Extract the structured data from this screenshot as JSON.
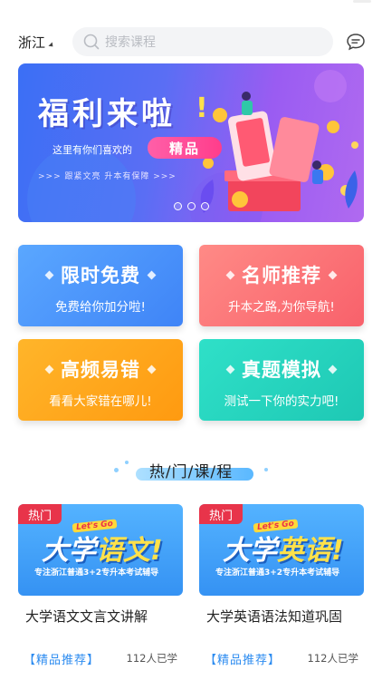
{
  "header": {
    "region": "浙江",
    "search_placeholder": "搜索课程"
  },
  "banner": {
    "title": "福利来啦",
    "exclaim": "!",
    "line1": "这里有你们喜欢的",
    "highlight": "精品",
    "line2": ">>> 跟紧文亮   升本有保障 >>>",
    "slides": 3,
    "active_slide": 2
  },
  "features": [
    {
      "title": "限时免费",
      "subtitle": "免费给你加分啦!"
    },
    {
      "title": "名师推荐",
      "subtitle": "升本之路,为你导航!"
    },
    {
      "title": "高频易错",
      "subtitle": "看看大家错在哪儿!"
    },
    {
      "title": "真题模拟",
      "subtitle": "测试一下你的实力吧!"
    }
  ],
  "section_title": "热/门/课/程",
  "courses": [
    {
      "hot": "热门",
      "logo": "Let's Go",
      "cover_prefix": "大学",
      "cover_highlight": "语文!",
      "cover_tagline": "专注浙江普通3+2专升本考试辅导",
      "name": "大学语文文言文讲解",
      "recommend": "【精品推荐】",
      "learners": "112人已学"
    },
    {
      "hot": "热门",
      "logo": "Let's Go",
      "cover_prefix": "大学",
      "cover_highlight": "英语!",
      "cover_tagline": "专注浙江普通3+2专升本考试辅导",
      "name": "大学英语语法知道巩固",
      "recommend": "【精品推荐】",
      "learners": "112人已学"
    }
  ],
  "colors": {
    "accent": "#2d8cf0",
    "hot": "#e8344a"
  }
}
